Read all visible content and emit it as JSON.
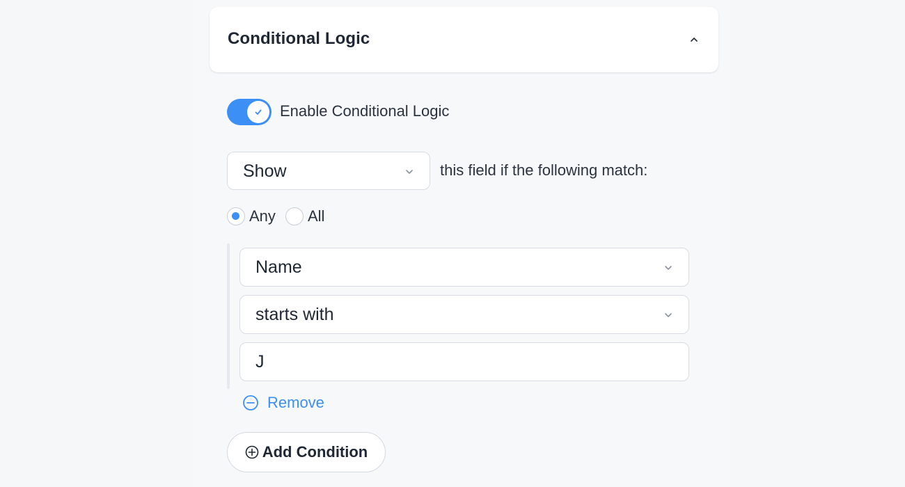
{
  "section": {
    "title": "Conditional Logic",
    "collapse_icon": "chevron-up-icon"
  },
  "toggle": {
    "label": "Enable Conditional Logic",
    "enabled": true,
    "accent": "#3b8ff5"
  },
  "action": {
    "selected": "Show",
    "suffix_text": "this field if the following match:"
  },
  "match_mode": {
    "options": [
      "Any",
      "All"
    ],
    "selected": "Any"
  },
  "condition": {
    "field": "Name",
    "operator": "starts with",
    "value": "J",
    "remove_label": "Remove"
  },
  "add_condition_label": "Add Condition"
}
